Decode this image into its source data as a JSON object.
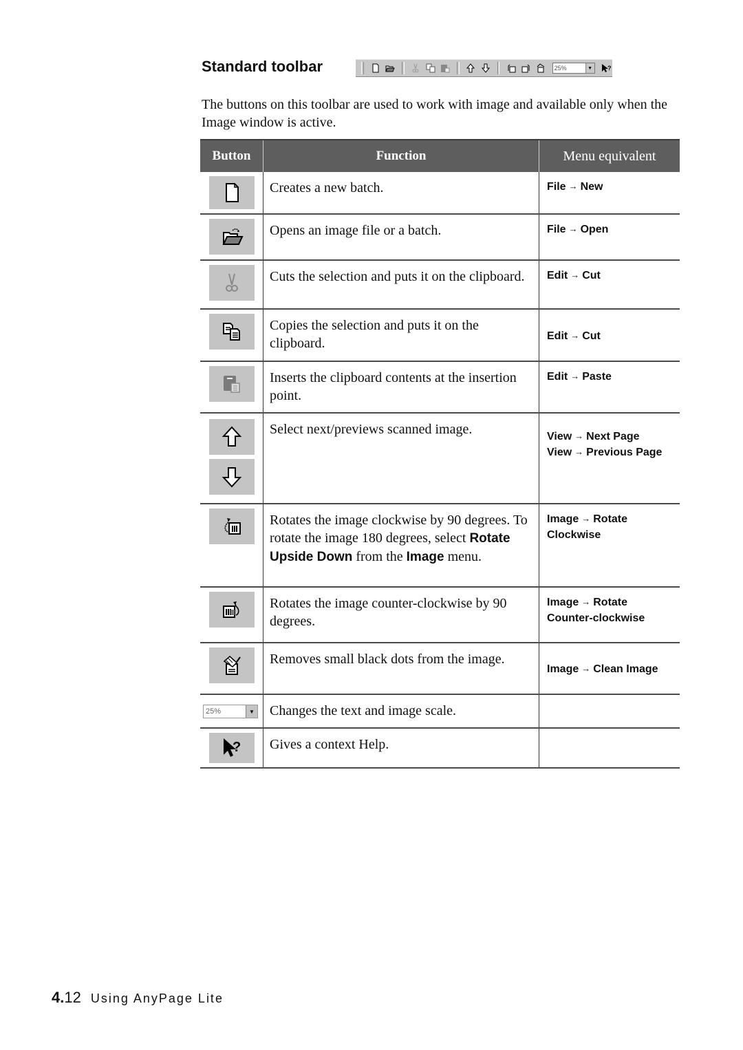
{
  "section": {
    "title": "Standard toolbar",
    "toolbar_zoom_value": "25%",
    "intro": "The buttons on this toolbar are used to work with image and available only when the Image window is active."
  },
  "table": {
    "headers": {
      "button": "Button",
      "function": "Function",
      "menu": "Menu equivalent"
    },
    "rows": [
      {
        "icon": "new-document-icon",
        "function": "Creates a new batch.",
        "menu": [
          {
            "menu": "File",
            "item": "New"
          }
        ]
      },
      {
        "icon": "open-folder-icon",
        "function": "Opens an image file or a batch.",
        "menu": [
          {
            "menu": "File",
            "item": "Open"
          }
        ]
      },
      {
        "icon": "scissors-icon",
        "function": "Cuts the selection and puts it on the clipboard.",
        "menu": [
          {
            "menu": "Edit",
            "item": "Cut"
          }
        ]
      },
      {
        "icon": "copy-icon",
        "function": "Copies the selection and puts it on the clipboard.",
        "menu": [
          {
            "menu": "Edit",
            "item": "Cut"
          }
        ]
      },
      {
        "icon": "paste-icon",
        "function": "Inserts the clipboard contents at the insertion point.",
        "menu": [
          {
            "menu": "Edit",
            "item": "Paste"
          }
        ]
      },
      {
        "icon": "arrow-up-icon,arrow-down-icon",
        "function": "Select next/previews scanned image.",
        "menu": [
          {
            "menu": "View",
            "item": "Next Page"
          },
          {
            "menu": "View",
            "item": "Previous Page"
          }
        ]
      },
      {
        "icon": "rotate-clockwise-icon",
        "function_parts": [
          "Rotates the image clockwise by 90 degrees. To rotate the image 180 degrees, select ",
          "Rotate Upside Down",
          " from the ",
          "Image",
          " menu."
        ],
        "menu": [
          {
            "menu": "Image",
            "item": "Rotate Clockwise"
          }
        ]
      },
      {
        "icon": "rotate-counterclockwise-icon",
        "function": "Rotates the image counter-clockwise by 90 degrees.",
        "menu": [
          {
            "menu": "Image",
            "item": "Rotate Counter-clockwise"
          }
        ]
      },
      {
        "icon": "clean-image-icon",
        "function": "Removes small black dots from the image.",
        "menu": [
          {
            "menu": "Image",
            "item": "Clean Image"
          }
        ]
      },
      {
        "icon": "zoom-combo",
        "zoom_value": "25%",
        "function": "Changes the text and image scale.",
        "menu": []
      },
      {
        "icon": "context-help-icon",
        "function": "Gives a context Help.",
        "menu": []
      }
    ]
  },
  "footer": {
    "chapter": "4.",
    "page": "12",
    "title": "Using AnyPage Lite"
  }
}
